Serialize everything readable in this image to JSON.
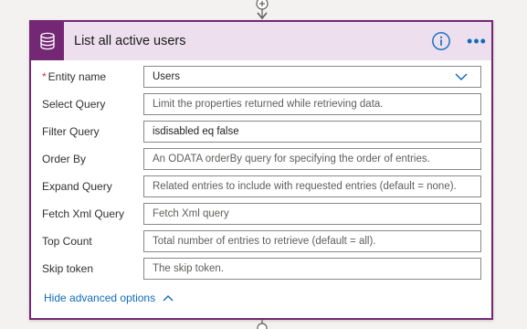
{
  "card": {
    "title": "List all active users",
    "info_icon": "info-icon",
    "more_icon": "more-options-icon",
    "more_glyph": "•••",
    "app_icon": "database-icon"
  },
  "fields": [
    {
      "label": "Entity name",
      "required": true,
      "value": "Users",
      "placeholder": "",
      "type": "select"
    },
    {
      "label": "Select Query",
      "required": false,
      "value": "",
      "placeholder": "Limit the properties returned while retrieving data."
    },
    {
      "label": "Filter Query",
      "required": false,
      "value": "isdisabled eq false",
      "placeholder": ""
    },
    {
      "label": "Order By",
      "required": false,
      "value": "",
      "placeholder": "An ODATA orderBy query for specifying the order of entries."
    },
    {
      "label": "Expand Query",
      "required": false,
      "value": "",
      "placeholder": "Related entries to include with requested entries (default = none)."
    },
    {
      "label": "Fetch Xml Query",
      "required": false,
      "value": "",
      "placeholder": "Fetch Xml query"
    },
    {
      "label": "Top Count",
      "required": false,
      "value": "",
      "placeholder": "Total number of entries to retrieve (default = all)."
    },
    {
      "label": "Skip token",
      "required": false,
      "value": "",
      "placeholder": "The skip token."
    }
  ],
  "required_marker": "*",
  "advanced": {
    "label": "Hide advanced options"
  },
  "colors": {
    "accent": "#742774",
    "header_bg": "#eddfee",
    "link": "#0f6cbd"
  }
}
